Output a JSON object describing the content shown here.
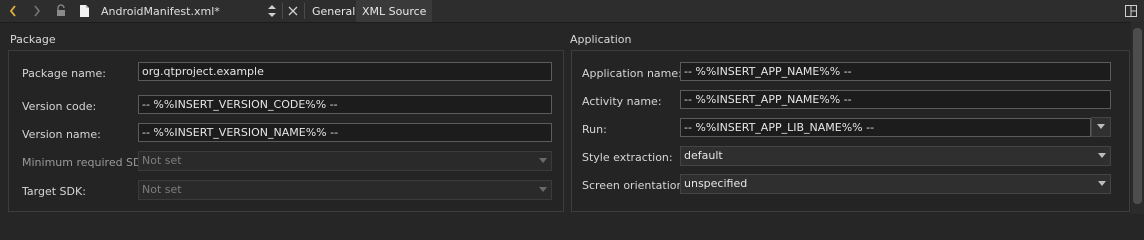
{
  "toolbar": {
    "file_name": "AndroidManifest.xml*",
    "tabs": [
      {
        "label": "General"
      },
      {
        "label": "XML Source"
      }
    ]
  },
  "package": {
    "title": "Package",
    "fields": {
      "package_name": {
        "label": "Package name:",
        "value": "org.qtproject.example"
      },
      "version_code": {
        "label": "Version code:",
        "value": "-- %%INSERT_VERSION_CODE%% --"
      },
      "version_name": {
        "label": "Version name:",
        "value": "-- %%INSERT_VERSION_NAME%% --"
      },
      "min_sdk": {
        "label": "Minimum required SDK:",
        "value": "Not set"
      },
      "target_sdk": {
        "label": "Target SDK:",
        "value": "Not set"
      }
    }
  },
  "application": {
    "title": "Application",
    "fields": {
      "app_name": {
        "label": "Application name:",
        "value": "-- %%INSERT_APP_NAME%% --"
      },
      "activity_name": {
        "label": "Activity name:",
        "value": "-- %%INSERT_APP_NAME%% --"
      },
      "run": {
        "label": "Run:",
        "value": "-- %%INSERT_APP_LIB_NAME%% --"
      },
      "style_extraction": {
        "label": "Style extraction:",
        "value": "default"
      },
      "screen_orientation": {
        "label": "Screen orientation:",
        "value": "unspecified"
      }
    }
  },
  "colors": {
    "background": "#262626",
    "toolbar": "#2d2d2d",
    "nav_arrow": "#e2b23a",
    "field_background": "#1c1c1c"
  }
}
